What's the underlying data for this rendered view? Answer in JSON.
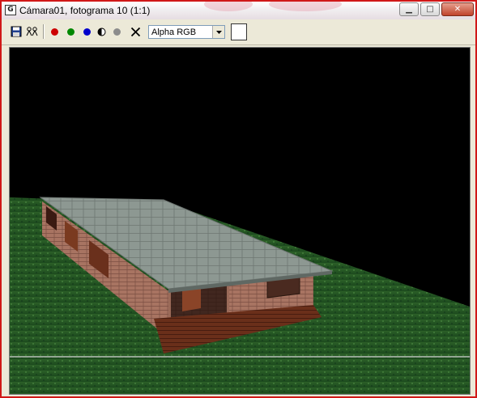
{
  "window": {
    "title": "Cámara01, fotograma 10 (1:1)",
    "app_icon": "frame-window-icon",
    "controls": {
      "minimize": "minimize-icon",
      "maximize": "maximize-icon",
      "close": "close-icon"
    }
  },
  "toolbar": {
    "save_icon": "save-icon",
    "clone_icon": "clone-window-icon",
    "channels": {
      "red": "#cc0000",
      "green": "#008800",
      "blue": "#0000cc"
    },
    "mono_icon": "monochrome-icon",
    "alpha_icon": "alpha-channel-icon",
    "clear_icon": "clear-icon",
    "channel_select": {
      "value": "Alpha RGB"
    },
    "color_swatch": "#ffffff"
  },
  "colors": {
    "frame_border": "#d01818",
    "viewport_bg": "#000000",
    "ground": "#2e6a2a",
    "roof": "#8f9a94",
    "brick": "#b07a66",
    "deck": "#6a2f1a"
  }
}
